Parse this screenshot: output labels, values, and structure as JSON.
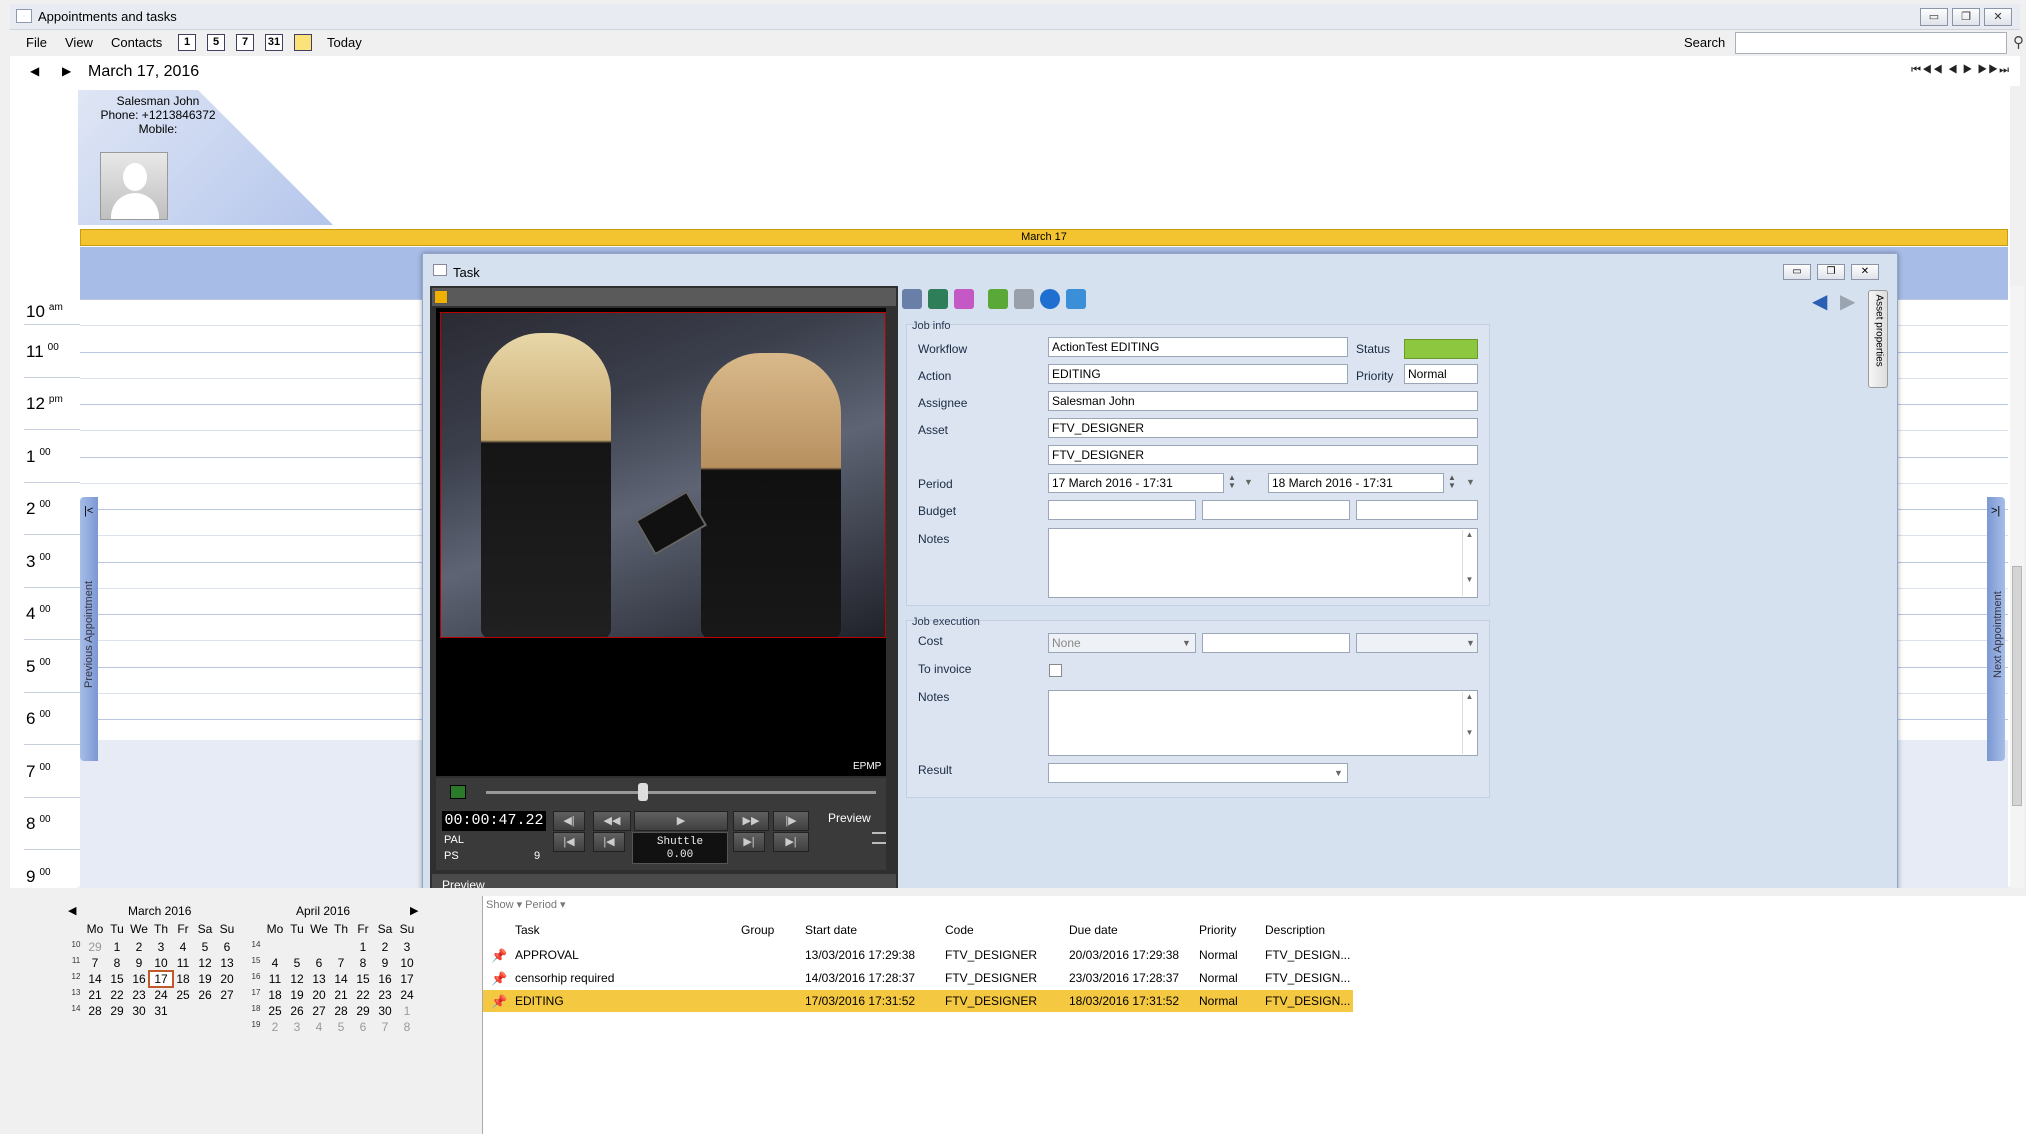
{
  "window": {
    "title": "Appointments and tasks",
    "min": "▭",
    "max": "❐",
    "close": "✕"
  },
  "menu": {
    "file": "File",
    "view": "View",
    "contacts": "Contacts",
    "v1": "1",
    "v5": "5",
    "v7": "7",
    "v31": "31",
    "today": "Today",
    "search_label": "Search"
  },
  "nav": {
    "date": "March 17, 2016",
    "prev": "◀",
    "next": "▶",
    "far": "⏮◀◀ ◀  ▶ ▶▶⏭"
  },
  "owner": {
    "name": "Salesman John",
    "phone": "Phone: +1213846372",
    "mobile": "Mobile:"
  },
  "day_header": "March 17",
  "hours": [
    {
      "h": "10",
      "s": "am"
    },
    {
      "h": "11",
      "s": "00"
    },
    {
      "h": "12",
      "s": "pm"
    },
    {
      "h": "1",
      "s": "00"
    },
    {
      "h": "2",
      "s": "00"
    },
    {
      "h": "3",
      "s": "00"
    },
    {
      "h": "4",
      "s": "00"
    },
    {
      "h": "5",
      "s": "00"
    },
    {
      "h": "6",
      "s": "00"
    },
    {
      "h": "7",
      "s": "00"
    },
    {
      "h": "8",
      "s": "00"
    },
    {
      "h": "9",
      "s": "00"
    }
  ],
  "side": {
    "prev_appointment": "Previous Appointment",
    "next_appointment": "Next Appointment"
  },
  "task_window": {
    "title": "Task",
    "asset_properties": "Asset properties"
  },
  "player": {
    "timecode": "00:00:47.22",
    "standard": "PAL",
    "ps_label": "PS",
    "ps_value": "9",
    "shuttle_label": "Shuttle",
    "shuttle_value": "0.00",
    "preview_label": "Preview",
    "brand": "EPMP",
    "preview_tab": "Preview"
  },
  "job_info": {
    "section": "Job info",
    "workflow_label": "Workflow",
    "workflow": "ActionTest EDITING",
    "status_label": "Status",
    "status_color": "#8dc63f",
    "action_label": "Action",
    "action": "EDITING",
    "priority_label": "Priority",
    "priority": "Normal",
    "assignee_label": "Assignee",
    "assignee": "Salesman John",
    "asset_label": "Asset",
    "asset": "FTV_DESIGNER",
    "asset2": "FTV_DESIGNER",
    "period_label": "Period",
    "period_start": "17 March 2016 - 17:31",
    "period_end": "18 March 2016 - 17:31",
    "budget_label": "Budget",
    "notes_label": "Notes"
  },
  "job_execution": {
    "section": "Job execution",
    "cost_label": "Cost",
    "cost_select": "None",
    "invoice_label": "To invoice",
    "notes_label": "Notes",
    "result_label": "Result"
  },
  "minical": {
    "march": {
      "title": "March  2016",
      "weeks": [
        {
          "wk": "10",
          "d": [
            "29",
            "1",
            "2",
            "3",
            "4",
            "5",
            "6"
          ]
        },
        {
          "wk": "11",
          "d": [
            "7",
            "8",
            "9",
            "10",
            "11",
            "12",
            "13"
          ]
        },
        {
          "wk": "12",
          "d": [
            "14",
            "15",
            "16",
            "17",
            "18",
            "19",
            "20"
          ]
        },
        {
          "wk": "13",
          "d": [
            "21",
            "22",
            "23",
            "24",
            "25",
            "26",
            "27"
          ]
        },
        {
          "wk": "14",
          "d": [
            "28",
            "29",
            "30",
            "31",
            "",
            "",
            ""
          ]
        }
      ]
    },
    "april": {
      "title": "April  2016",
      "weeks": [
        {
          "wk": "14",
          "d": [
            "",
            "",
            "",
            "",
            "1",
            "2",
            "3"
          ]
        },
        {
          "wk": "15",
          "d": [
            "4",
            "5",
            "6",
            "7",
            "8",
            "9",
            "10"
          ]
        },
        {
          "wk": "16",
          "d": [
            "11",
            "12",
            "13",
            "14",
            "15",
            "16",
            "17"
          ]
        },
        {
          "wk": "17",
          "d": [
            "18",
            "19",
            "20",
            "21",
            "22",
            "23",
            "24"
          ]
        },
        {
          "wk": "18",
          "d": [
            "25",
            "26",
            "27",
            "28",
            "29",
            "30",
            "1"
          ]
        },
        {
          "wk": "19",
          "d": [
            "2",
            "3",
            "4",
            "5",
            "6",
            "7",
            "8"
          ]
        }
      ]
    },
    "dows": [
      "Mo",
      "Tu",
      "We",
      "Th",
      "Fr",
      "Sa",
      "Su"
    ]
  },
  "tasklist": {
    "show": "Show ▾   Period ▾",
    "headers": {
      "task": "Task",
      "group": "Group",
      "start": "Start date",
      "code": "Code",
      "due": "Due date",
      "priority": "Priority",
      "desc": "Description"
    },
    "rows": [
      {
        "task": "APPROVAL",
        "group": "",
        "start": "13/03/2016 17:29:38",
        "code": "FTV_DESIGNER",
        "due": "20/03/2016 17:29:38",
        "priority": "Normal",
        "desc": "FTV_DESIGN..."
      },
      {
        "task": "censorhip required",
        "group": "",
        "start": "14/03/2016 17:28:37",
        "code": "FTV_DESIGNER",
        "due": "23/03/2016 17:28:37",
        "priority": "Normal",
        "desc": "FTV_DESIGN..."
      },
      {
        "task": "EDITING",
        "group": "",
        "start": "17/03/2016 17:31:52",
        "code": "FTV_DESIGNER",
        "due": "18/03/2016 17:31:52",
        "priority": "Normal",
        "desc": "FTV_DESIGN..."
      }
    ]
  }
}
